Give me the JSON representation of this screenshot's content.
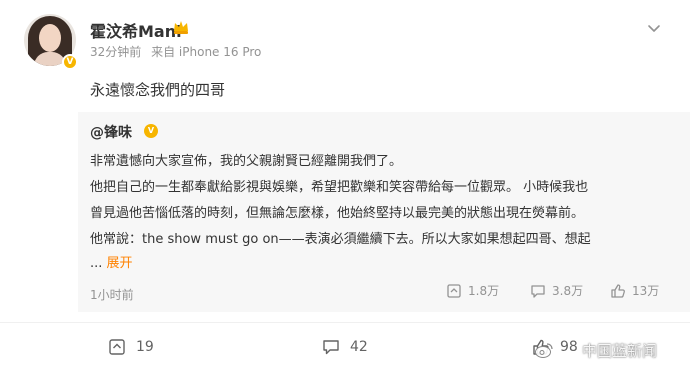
{
  "post": {
    "username": "霍汶希Mani",
    "time": "32分钟前",
    "source": "来自 iPhone 16 Pro",
    "text": "永遠懷念我們的四哥"
  },
  "repost": {
    "username": "@锋味",
    "lines": [
      "非常遺憾向大家宣佈，我的父親謝賢已經離開我們了。",
      "他把自己的一生都奉獻給影視與娛樂，希望把歡樂和笑容帶給每一位觀眾。 小時候我也",
      "曾見過他苦惱低落的時刻，但無論怎麼樣，他始終堅持以最完美的狀態出現在熒幕前。",
      "他常說：the show must go on——表演必須繼續下去。所以大家如果想起四哥、想起"
    ],
    "ellipsis": "...",
    "expand": "展开",
    "time": "1小时前",
    "reposts": "1.8万",
    "comments": "3.8万",
    "likes": "13万"
  },
  "actions": {
    "reposts": "19",
    "comments": "42",
    "likes": "98"
  },
  "watermark": "中国蓝新闻",
  "icons": {
    "more": "chevron-down-icon",
    "crown": "crown-icon",
    "verified": "verified-badge-icon",
    "repost": "repost-icon",
    "comment": "comment-icon",
    "like": "like-icon"
  },
  "colors": {
    "accent": "#ff8200",
    "badge": "#f7b500",
    "muted": "#939393",
    "repost_bg": "#f7f7f7"
  }
}
